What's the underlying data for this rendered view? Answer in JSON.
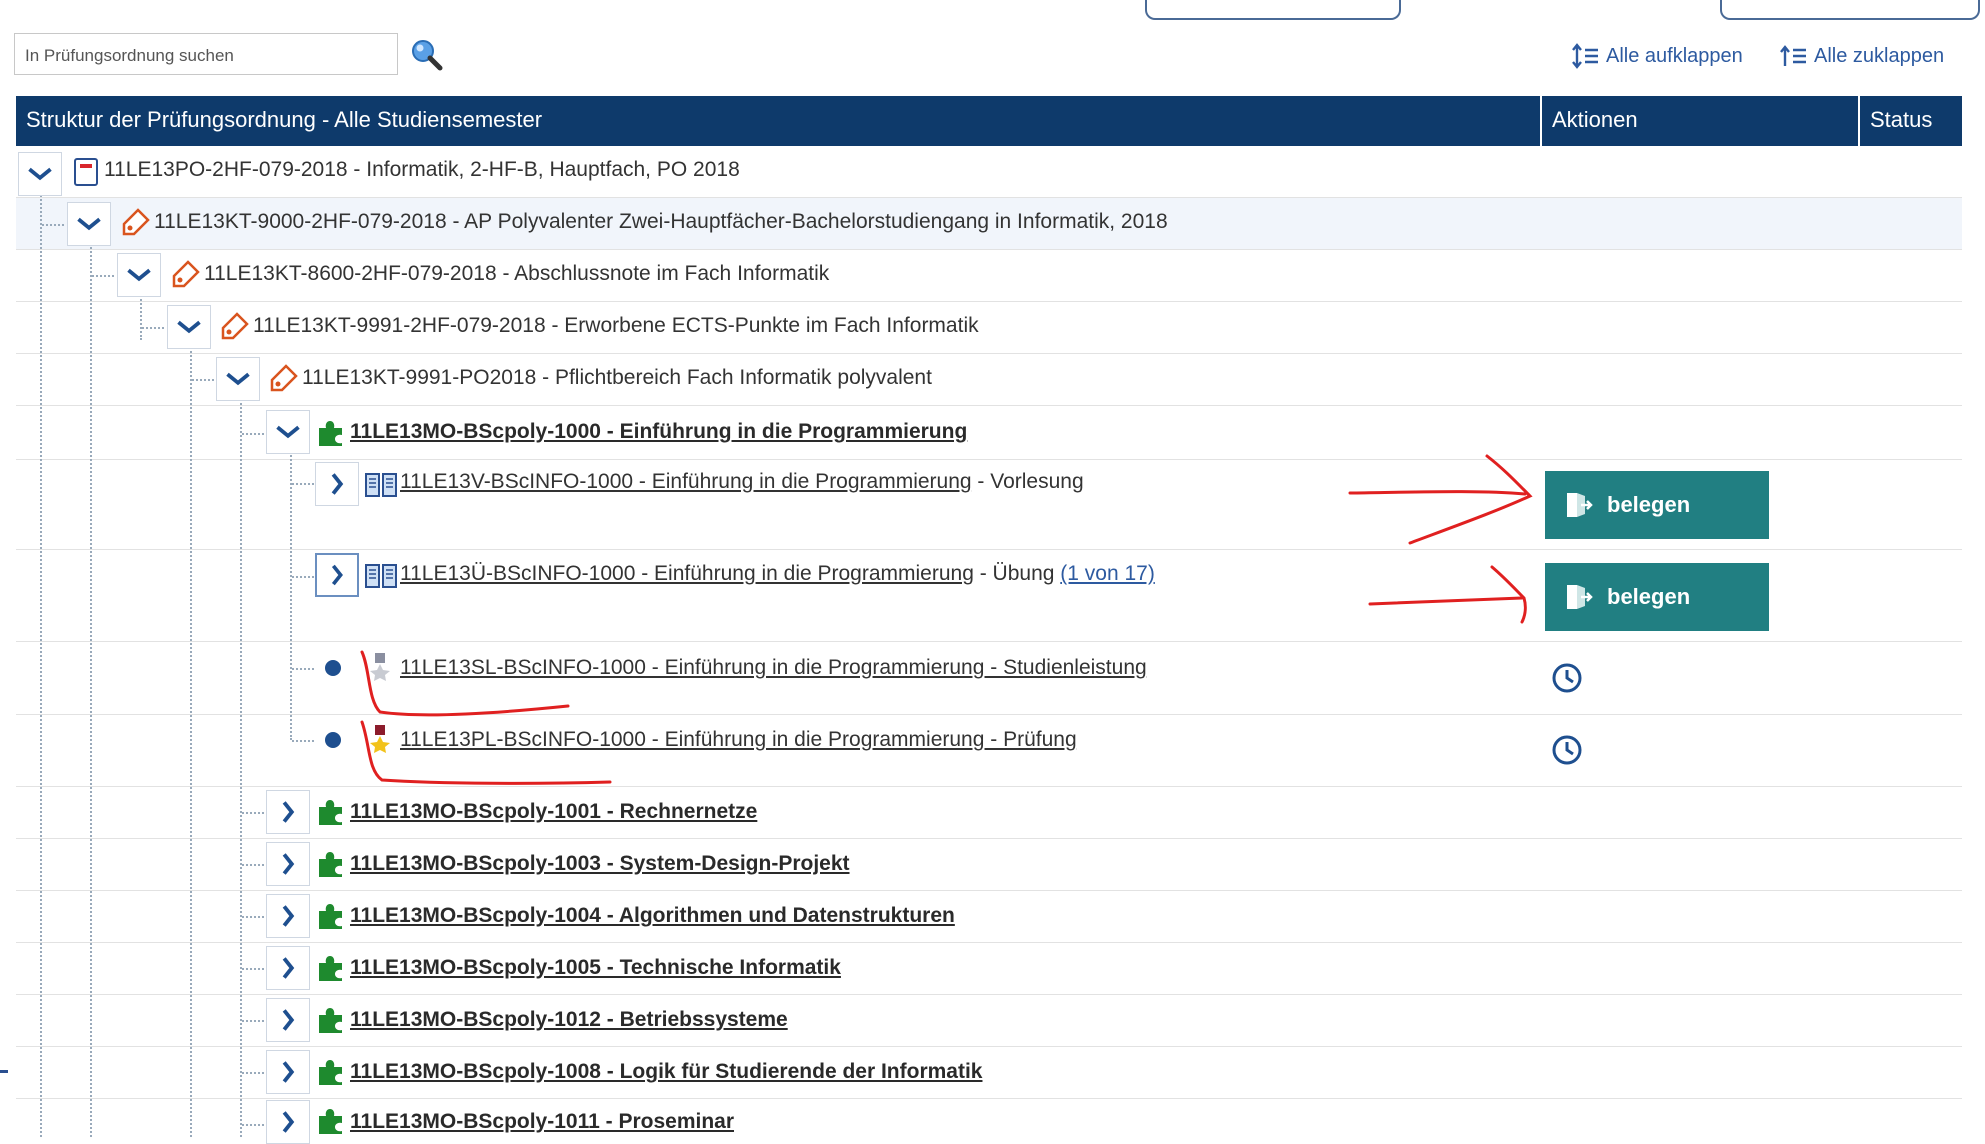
{
  "search": {
    "placeholder": "In Prüfungsordnung suchen"
  },
  "toolbar": {
    "expand_all": "Alle aufklappen",
    "collapse_all": "Alle zuklappen"
  },
  "table": {
    "headers": {
      "structure": "Struktur der Prüfungsordnung - Alle Studiensemester",
      "actions": "Aktionen",
      "status": "Status"
    }
  },
  "rows": {
    "po": "11LE13PO-2HF-079-2018 - Informatik, 2-HF-B, Hauptfach, PO 2018",
    "kt9000": "11LE13KT-9000-2HF-079-2018 - AP Polyvalenter Zwei-Hauptfächer-Bachelorstudiengang in Informatik, 2018",
    "kt8600": "11LE13KT-8600-2HF-079-2018 - Abschlussnote im Fach Informatik",
    "kt9991": "11LE13KT-9991-2HF-079-2018 - Erworbene ECTS-Punkte im Fach Informatik",
    "kt9991po": "11LE13KT-9991-PO2018 - Pflichtbereich Fach Informatik polyvalent",
    "mo1000": "11LE13MO-BScpoly-1000 - Einführung in die Programmierung",
    "v1000": "11LE13V-BScINFO-1000 - Einführung in die Programmierung",
    "v1000_suffix": "- Vorlesung",
    "u1000": "11LE13Ü-BScINFO-1000 - Einführung in die Programmierung",
    "u1000_suffix": "- Übung",
    "u1000_count": "(1 von 17)",
    "sl1000": "11LE13SL-BScINFO-1000 - Einführung in die Programmierung - Studienleistung",
    "pl1000": "11LE13PL-BScINFO-1000 - Einführung in die Programmierung - Prüfung",
    "mo1001": "11LE13MO-BScpoly-1001 - Rechnernetze",
    "mo1003": "11LE13MO-BScpoly-1003 - System-Design-Projekt",
    "mo1004": "11LE13MO-BScpoly-1004 - Algorithmen und Datenstrukturen",
    "mo1005": "11LE13MO-BScpoly-1005 - Technische Informatik",
    "mo1012": "11LE13MO-BScpoly-1012 - Betriebssysteme",
    "mo1008": "11LE13MO-BScpoly-1008 - Logik für Studierende der Informatik",
    "mo1011": "11LE13MO-BScpoly-1011 - Proseminar"
  },
  "actions": {
    "belegen": "belegen"
  },
  "colors": {
    "header_bg": "#0e3a6b",
    "action_button": "#217f82",
    "link": "#2d5aa0",
    "module_icon": "#1e8a2e",
    "annotation": "#e02020"
  },
  "icons": {
    "search": "magnifier-icon",
    "expand_all": "expand-all-icon",
    "collapse_all": "collapse-all-icon",
    "po": "document-icon",
    "kt": "tag-icon",
    "module": "puzzle-icon",
    "course": "book-icon",
    "sl": "medal-grey-icon",
    "pl": "medal-star-icon",
    "belegen": "enroll-door-icon",
    "status": "clock-icon"
  }
}
